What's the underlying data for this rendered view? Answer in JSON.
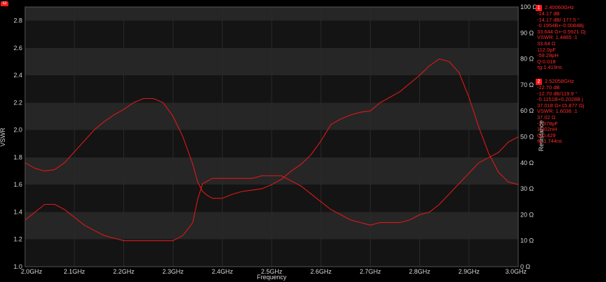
{
  "corner_badge": "S2",
  "markers": [
    {
      "number": "1",
      "lines": [
        "2.40060GHz",
        "-14.17 dB",
        "-14.17 dB/-177.5 °",
        "-0.1954B+-0.0084Bj",
        "33.644 Ω+-0.5921 Ωj",
        "VSWR: 1.4865 :1",
        "33.64 Ω",
        "112.0pF",
        "-59.28pH",
        "Q:0.018",
        "τg:1.419ns"
      ]
    },
    {
      "number": "2",
      "lines": [
        "2.52058GHz",
        "-12.70 dB",
        "-12.70 dB/119.9 °",
        "-0.1151B+0.2028B j",
        "37.018 Ω+15.877 Ωj",
        "VSWR: 1.6036 :1",
        "37.02 Ω",
        "-3.978pF",
        "1.002nH",
        "Q:0.429",
        "τg:1.744ns"
      ]
    }
  ],
  "chart_data": {
    "type": "line",
    "xlabel": "Frequency",
    "ylabel_left": "VSWR",
    "ylabel_right": "Resistance",
    "xlim": [
      2.0,
      3.0
    ],
    "ylim_left": [
      1.0,
      2.9
    ],
    "ylim_right": [
      0,
      100
    ],
    "x_tick_labels": [
      "2.0GHz",
      "2.1GHz",
      "2.2GHz",
      "2.3GHz",
      "2.4GHz",
      "2.5GHz",
      "2.6GHz",
      "2.7GHz",
      "2.8GHz",
      "2.9GHz",
      "3.0GHz"
    ],
    "y_left_tick_labels": [
      "1.0",
      "1.2",
      "1.4",
      "1.6",
      "1.8",
      "2.0",
      "2.2",
      "2.4",
      "2.6",
      "2.8"
    ],
    "y_right_tick_labels": [
      "0 Ω",
      "10 Ω",
      "20 Ω",
      "30 Ω",
      "40 Ω",
      "50 Ω",
      "60 Ω",
      "70 Ω",
      "80 Ω",
      "90 Ω",
      "100 Ω"
    ],
    "grid": true,
    "line_color": "#e01818",
    "series": [
      {
        "axis": "left",
        "x": [
          2.0,
          2.02,
          2.04,
          2.06,
          2.08,
          2.1,
          2.12,
          2.14,
          2.16,
          2.18,
          2.2,
          2.22,
          2.24,
          2.25,
          2.26,
          2.28,
          2.3,
          2.32,
          2.34,
          2.35,
          2.36,
          2.37,
          2.38,
          2.4,
          2.42,
          2.44,
          2.46,
          2.48,
          2.5,
          2.52,
          2.54,
          2.56,
          2.58,
          2.6,
          2.62,
          2.64,
          2.66,
          2.68,
          2.7,
          2.72,
          2.74,
          2.76,
          2.78,
          2.8,
          2.82,
          2.84,
          2.86,
          2.88,
          2.9,
          2.92,
          2.94,
          2.96,
          2.98,
          3.0
        ],
        "y": [
          1.76,
          1.72,
          1.7,
          1.71,
          1.76,
          1.84,
          1.92,
          2.0,
          2.06,
          2.11,
          2.15,
          2.2,
          2.23,
          2.23,
          2.23,
          2.2,
          2.1,
          1.95,
          1.75,
          1.62,
          1.55,
          1.52,
          1.5,
          1.5,
          1.53,
          1.55,
          1.56,
          1.57,
          1.6,
          1.64,
          1.7,
          1.75,
          1.82,
          1.92,
          2.04,
          2.08,
          2.11,
          2.13,
          2.14,
          2.2,
          2.24,
          2.28,
          2.34,
          2.4,
          2.47,
          2.52,
          2.5,
          2.42,
          2.24,
          2.02,
          1.83,
          1.69,
          1.62,
          1.6
        ]
      },
      {
        "axis": "right",
        "x": [
          2.0,
          2.02,
          2.04,
          2.06,
          2.08,
          2.1,
          2.12,
          2.14,
          2.16,
          2.18,
          2.2,
          2.22,
          2.24,
          2.26,
          2.28,
          2.3,
          2.32,
          2.34,
          2.35,
          2.36,
          2.37,
          2.38,
          2.4,
          2.42,
          2.44,
          2.46,
          2.48,
          2.5,
          2.52,
          2.54,
          2.56,
          2.58,
          2.6,
          2.62,
          2.64,
          2.66,
          2.68,
          2.7,
          2.72,
          2.74,
          2.76,
          2.78,
          2.8,
          2.82,
          2.84,
          2.86,
          2.88,
          2.9,
          2.92,
          2.94,
          2.96,
          2.98,
          3.0
        ],
        "y": [
          18,
          21,
          24,
          24,
          22,
          19,
          16,
          14,
          12,
          11,
          10,
          10,
          10,
          10,
          10,
          10,
          12,
          17,
          26,
          32,
          33,
          34,
          34,
          34,
          34,
          34,
          35,
          35,
          35,
          33,
          31,
          28,
          25,
          22,
          20,
          18,
          17,
          16,
          17,
          17,
          17,
          18,
          20,
          21,
          24,
          28,
          32,
          36,
          40,
          42,
          44,
          48,
          50
        ]
      }
    ]
  }
}
